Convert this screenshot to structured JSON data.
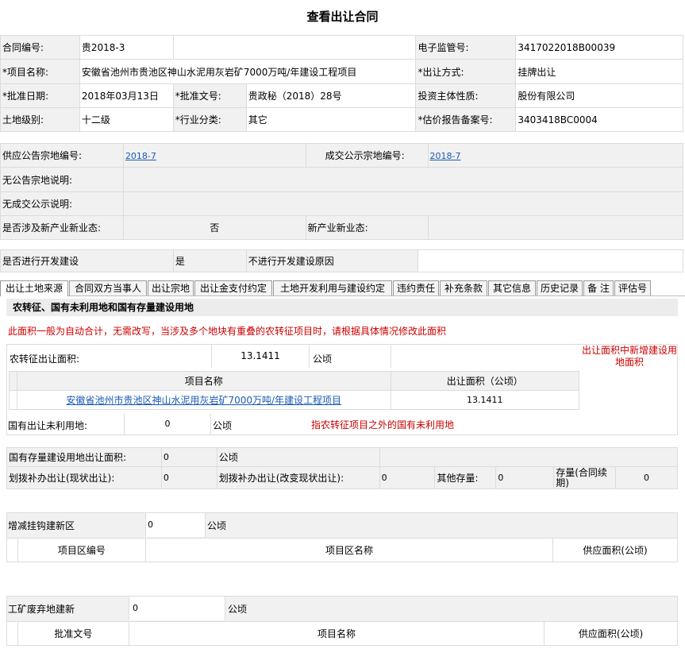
{
  "page_title": "查看出让合同",
  "header": {
    "contract_no_label": "合同编号:",
    "contract_no": "贵2018-3",
    "ecode_label": "电子监管号:",
    "ecode": "3417022018B00039",
    "project_name_label": "*项目名称:",
    "project_name": "安徽省池州市贵池区神山水泥用灰岩矿7000万吨/年建设工程项目",
    "transfer_method_label": "*出让方式:",
    "transfer_method": "挂牌出让",
    "approve_date_label": "*批准日期:",
    "approve_date": "2018年03月13日",
    "approve_doc_label": "*批准文号:",
    "approve_doc": "贵政秘（2018）28号",
    "investor_label": "投资主体性质:",
    "investor": "股份有限公司",
    "land_level_label": "土地级别:",
    "land_level": "十二级",
    "industry_label": "*行业分类:",
    "industry": "其它",
    "estimate_label": "*估价报告备案号:",
    "estimate": "3403418BC0004"
  },
  "supply": {
    "notice_no_label": "供应公告宗地编号:",
    "notice_no": "2018-7",
    "deal_no_label": "成交公示宗地编号:",
    "deal_no": "2018-7",
    "no_notice_label": "无公告宗地说明:",
    "no_deal_label": "无成交公示说明:",
    "new_industry_label": "是否涉及新产业新业态:",
    "new_industry": "否",
    "new_industry_type_label": "新产业新业态:",
    "develop_label": "是否进行开发建设",
    "develop": "是",
    "no_develop_label": "不进行开发建设原因"
  },
  "tabs": [
    "出让土地来源",
    "合同双方当事人",
    "出让宗地",
    "出让金支付约定",
    "土地开发利用与建设约定",
    "违约责任",
    "补充条款",
    "其它信息",
    "历史记录",
    "备 注",
    "评估号"
  ],
  "source": {
    "section_title": "农转征、国有未利用地和国有存量建设用地",
    "notice": "此面积一般为自动合计，无需改写，当涉及多个地块有重叠的农转征项目时，请根据具体情况修改此面积",
    "farm_area_label": "农转征出让面积:",
    "farm_area": "13.1411",
    "unit": "公顷",
    "new_build_note": "出让面积中新增建设用地面积",
    "col_project": "项目名称",
    "col_area": "出让面积（公顷）",
    "rows": [
      {
        "name": "安徽省池州市贵池区神山水泥用灰岩矿7000万吨/年建设工程项目",
        "area": "13.1411"
      }
    ],
    "state_unused_label": "国有出让未利用地:",
    "state_unused": "0",
    "state_unused_note": "指农转征项目之外的国有未利用地",
    "stock_label": "国有存量建设用地出让面积:",
    "stock": "0",
    "alloc_label": "划拨补办出让(现状出让):",
    "alloc": "0",
    "alloc_change_label": "划拨补办出让(改变现状出让):",
    "alloc_change": "0",
    "other_stock_label": "其他存量:",
    "other_stock": "0",
    "renew_label": "存量(合同续期)",
    "renew": "0",
    "link_label": "增减挂钩建新区",
    "link_value": "0",
    "link_col1": "项目区编号",
    "link_col2": "项目区名称",
    "link_col3": "供应面积(公顷)",
    "mine_label": "工矿废弃地建新",
    "mine_value": "0",
    "mine_col1": "批准文号",
    "mine_col2": "项目名称",
    "mine_col3": "供应面积(公顷)"
  }
}
